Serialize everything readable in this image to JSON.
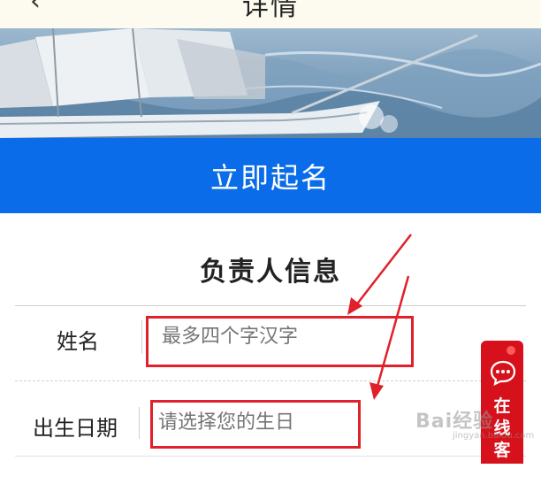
{
  "header": {
    "back_icon": "chevron-left-icon",
    "title": "详情"
  },
  "banner": {
    "image": "sailing-ship-on-sea"
  },
  "cta": {
    "label": "立即起名"
  },
  "section": {
    "title": "负责人信息"
  },
  "form": {
    "name": {
      "label": "姓名",
      "placeholder": "最多四个字汉字"
    },
    "birthday": {
      "label": "出生日期",
      "placeholder": "请选择您的生日"
    }
  },
  "float_service": {
    "label": "在线客服",
    "icon": "chat-bubble-icon"
  },
  "annotation": {
    "color": "#e0202a"
  },
  "colors": {
    "primary": "#0a6ce8",
    "service": "#d7111b"
  }
}
